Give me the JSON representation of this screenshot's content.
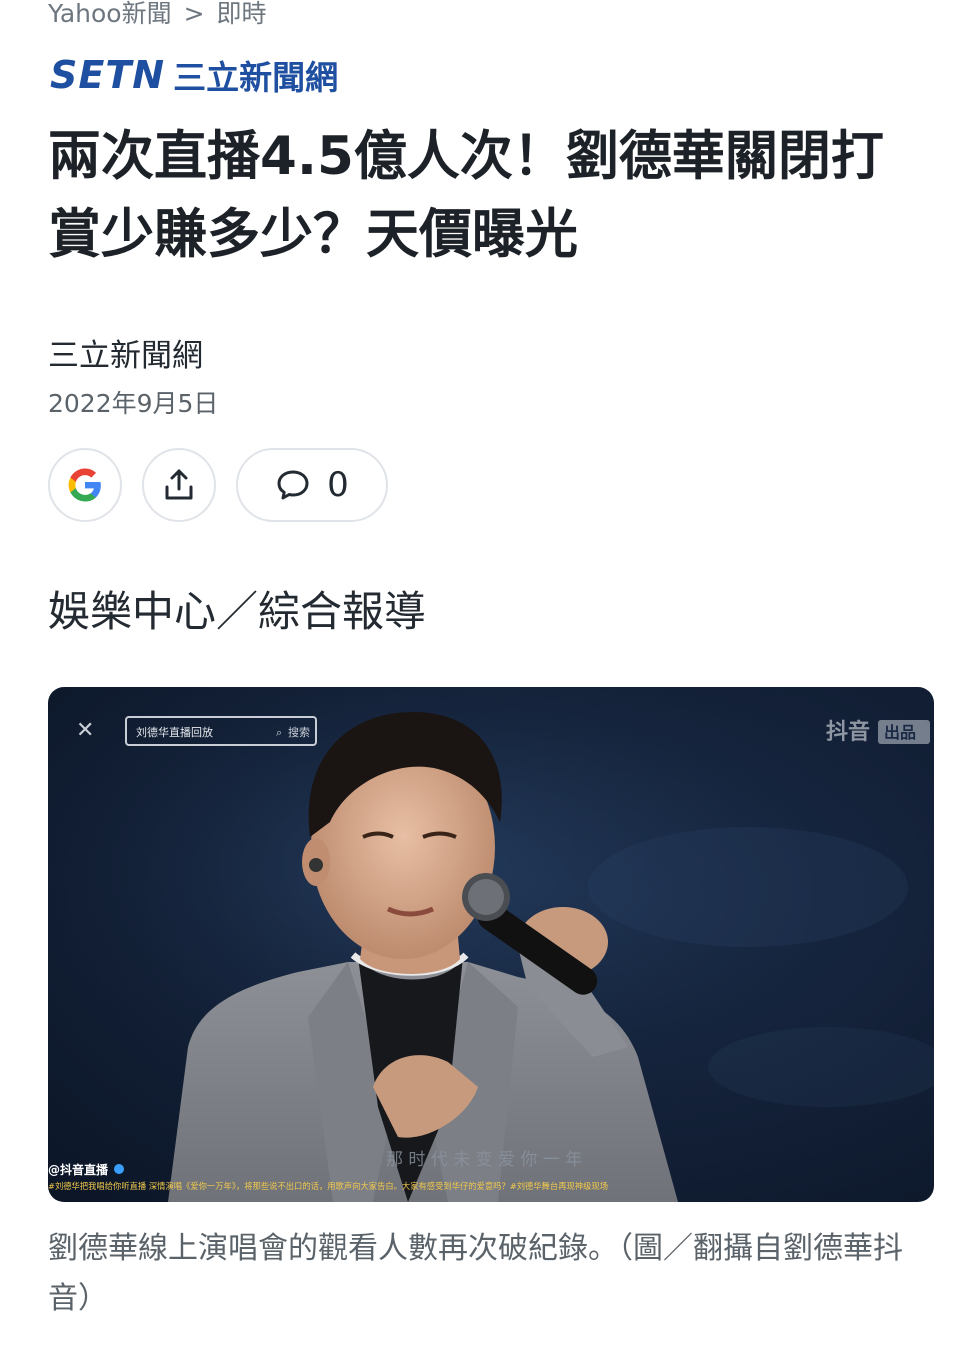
{
  "breadcrumb": {
    "home": "Yahoo新聞",
    "separator": ">",
    "current": "即時"
  },
  "logo": {
    "mark": "SETN",
    "text": "三立新聞網",
    "color": "#1f4fa0"
  },
  "article": {
    "headline": "兩次直播4.5億人次！劉德華關閉打賞少賺多少？天價曝光",
    "source": "三立新聞網",
    "date": "2022年9月5日",
    "dateline": "娛樂中心／綜合報導"
  },
  "actions": {
    "google_icon": "google-icon",
    "share_icon": "share-icon",
    "comment_icon": "comment-icon",
    "comment_count": "0"
  },
  "photo": {
    "search_text": "刘德华直播回放",
    "search_button": "搜索",
    "watermark": "抖音",
    "watermark_badge": "出品",
    "account": "@抖音直播",
    "ticker": "#刘德华把我唱给你听直播 深情演唱《爱你一万年》，将那些说不出口的话，用歌声向大家告白。大家有感受到华仔的爱意吗？#刘德华舞台再现神级现场",
    "lyric": "那 时 代 未 变 爱 你 一 年"
  },
  "caption": "劉德華線上演唱會的觀看人數再次破紀錄。（圖／翻攝自劉德華抖音）"
}
